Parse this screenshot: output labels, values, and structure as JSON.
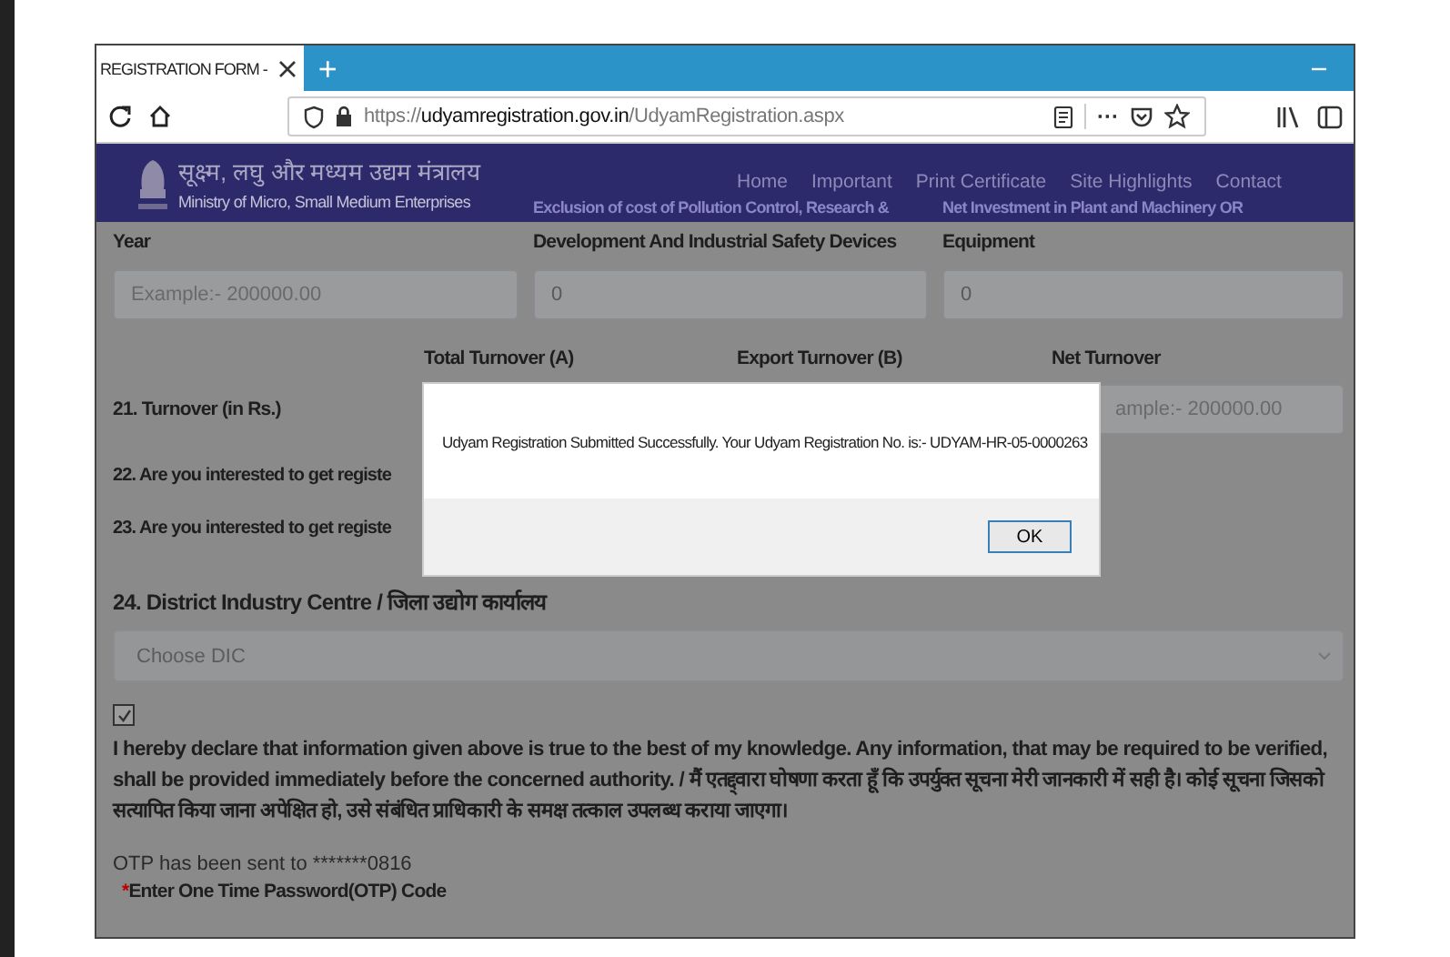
{
  "browser": {
    "tab": {
      "title": "REGISTRATION FORM -",
      "selected": true
    },
    "new_tab": "+",
    "url": {
      "scheme": "https://",
      "domain": "udyamregistration.gov.in",
      "path": "/UdyamRegistration.aspx"
    },
    "more": "···"
  },
  "header": {
    "hindi_title": "सूक्ष्म, लघु और मध्यम उद्यम मंत्रालय",
    "ministry": "Ministry of Micro, Small Medium Enterprises",
    "nav": [
      "Home",
      "Important",
      "Print Certificate",
      "Site Highlights",
      "Contact"
    ],
    "behind_headings": [
      "Exclusion of cost of Pollution Control, Research &",
      "Net Investment in Plant and Machinery OR"
    ]
  },
  "investment": [
    {
      "heading": "Year",
      "placeholder": "Example:- 200000.00"
    },
    {
      "heading": "Development And Industrial Safety Devices",
      "value": "0"
    },
    {
      "heading": "Equipment",
      "value": "0"
    }
  ],
  "turnover": {
    "label": "21. Turnover (in Rs.)",
    "columns": [
      "Total Turnover (A)",
      "Export Turnover (B)",
      "Net Turnover"
    ],
    "net_placeholder": "ample:- 200000.00"
  },
  "questions": [
    "22. Are you interested to get registe",
    "23. Are you interested to get registe"
  ],
  "dialog": {
    "message": "Udyam Registration Submitted Successfully. Your Udyam Registration No. is:- UDYAM-HR-05-0000263",
    "button": "OK"
  },
  "dic": {
    "label": "24. District Industry Centre / जिला उद्योग कार्यालय",
    "value": "Choose DIC"
  },
  "declaration": {
    "checked": true,
    "text": "I hereby declare that information given above is true to the best of my knowledge. Any information, that may be required to be verified, shall be provided immediately before the concerned authority. / मैं एतद्द्वारा घोषणा करता हूँ कि उपर्युक्त सूचना मेरी जानकारी में सही है। कोई सूचना जिसको सत्यापित किया जाना अपेक्षित हो, उसे संबंधित प्राधिकारी के समक्ष तत्काल उपलब्ध कराया जाएगा।"
  },
  "otp": {
    "sent": "OTP has been sent to *******0816",
    "required_mark": "*",
    "label": "Enter One Time Password(OTP) Code"
  }
}
